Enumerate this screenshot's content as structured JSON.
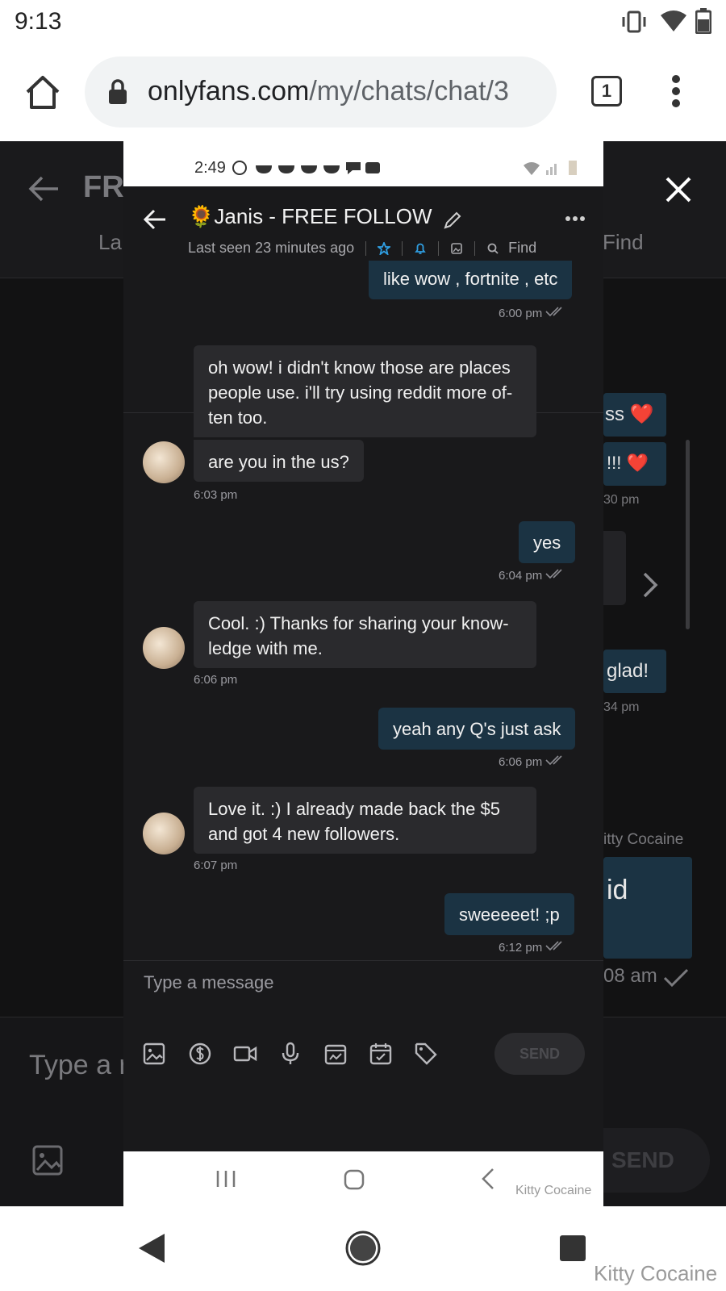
{
  "status_bar": {
    "time": "9:13"
  },
  "browser": {
    "url_host": "onlyfans.com",
    "url_path": "/my/chats/chat/3",
    "tab_count": "1"
  },
  "background_page": {
    "title_fragment": "FR",
    "tab_fragment": "La",
    "find_label": "Find",
    "bubble_1": "ss ❤️",
    "bubble_2": "!!! ❤️",
    "time_1": "30 pm",
    "bubble_3": "glad!",
    "time_2": "34 pm",
    "sender_name": "itty Cocaine",
    "bubble_4": "id",
    "time_3": "08 am",
    "input_placeholder": "Type a r",
    "send_label": "SEND"
  },
  "inner_screenshot": {
    "status_time": "2:49",
    "contact_name": "🌻Janis - FREE FOLLOW",
    "last_seen": "Last seen 23 minutes ago",
    "find_label": "Find",
    "messages": [
      {
        "dir": "out",
        "text": "like wow , fortnite , etc",
        "time": "6:00 pm"
      },
      {
        "dir": "in",
        "lines": [
          "oh wow! i didn't know those are places",
          "people use. i'll try using reddit more of-",
          "ten too."
        ]
      },
      {
        "dir": "in",
        "text": "are you in the us?",
        "time": "6:03 pm"
      },
      {
        "dir": "out",
        "text": "yes",
        "time": "6:04 pm"
      },
      {
        "dir": "in",
        "lines": [
          "Cool. :) Thanks for sharing your know-",
          "ledge with me."
        ],
        "time": "6:06 pm"
      },
      {
        "dir": "out",
        "text": "yeah any Q's just ask",
        "time": "6:06 pm"
      },
      {
        "dir": "in",
        "lines": [
          "Love it. :) I already made back the $5",
          "and got 4 new followers."
        ],
        "time": "6:07 pm"
      },
      {
        "dir": "out",
        "text": "sweeeeet! ;p",
        "time": "6:12 pm"
      }
    ],
    "composer_placeholder": "Type a message",
    "send_label": "SEND",
    "watermark": "Kitty Cocaine"
  },
  "watermark": "Kitty Cocaine",
  "colors": {
    "outgoing_bubble": "#1b3343",
    "incoming_bubble": "#2a2a2d",
    "accent_blue": "#2f9de0"
  }
}
